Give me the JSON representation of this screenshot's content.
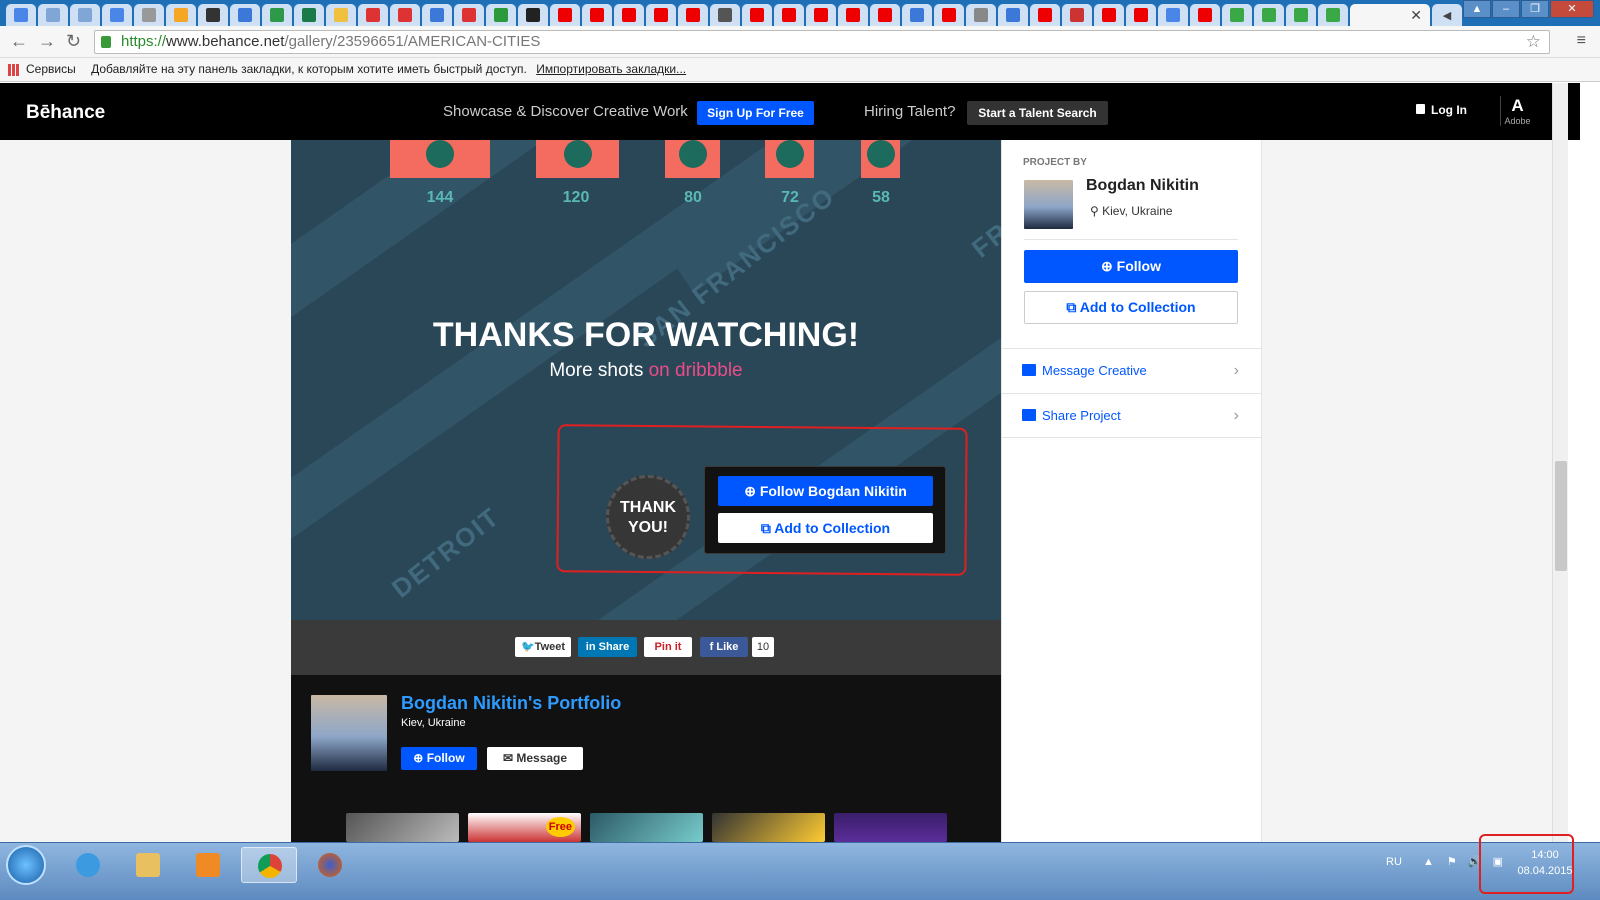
{
  "browser": {
    "url_https": "https://",
    "url_host": "www.behance.net",
    "url_path": "/gallery/23596651/AMERICAN-CITIES",
    "bookmarks_apps": "Сервисы",
    "bookmarks_hint": "Добавляйте на эту панель закладки, к которым хотите иметь быстрый доступ.",
    "bookmarks_import": "Импортировать закладки..."
  },
  "header": {
    "logo": "Bēhance",
    "tagline": "Showcase & Discover Creative Work",
    "signup": "Sign Up For Free",
    "hiring": "Hiring Talent?",
    "talent": "Start a Talent Search",
    "login": "Log In",
    "adobe": "Adobe"
  },
  "project": {
    "chart_values": [
      "144",
      "120",
      "80",
      "72",
      "58"
    ],
    "thanks": "THANKS FOR WATCHING!",
    "more_prefix": "More shots ",
    "more_link": "on dribbble",
    "badge_line1": "THANK",
    "badge_line2": "YOU!",
    "cta_follow": "Follow Bogdan Nikitin",
    "cta_collection": "Add to Collection",
    "bg_city_1": "SAN FRANCISCO",
    "bg_city_2": "DETROIT",
    "bg_city_3": "FRE"
  },
  "share": {
    "tweet": "Tweet",
    "linkedin": "Share",
    "pinterest": "Pin it",
    "facebook": "Like",
    "fb_count": "10"
  },
  "portfolio": {
    "name": "Bogdan Nikitin's Portfolio",
    "location": "Kiev, Ukraine",
    "follow": "Follow",
    "message": "Message",
    "thumb_badge": "Free"
  },
  "sidebar": {
    "project_by": "PROJECT BY",
    "name": "Bogdan Nikitin",
    "location": "Kiev, Ukraine",
    "follow": "Follow",
    "add_collection": "Add to Collection",
    "message": "Message Creative",
    "share": "Share Project"
  },
  "taskbar": {
    "lang": "RU",
    "time": "14:00",
    "date": "08.04.2015"
  },
  "colors": {
    "accent": "#0057ff",
    "dribbble": "#ea4c89",
    "project_bg": "#2a4757",
    "bar": "#f36c5f"
  }
}
